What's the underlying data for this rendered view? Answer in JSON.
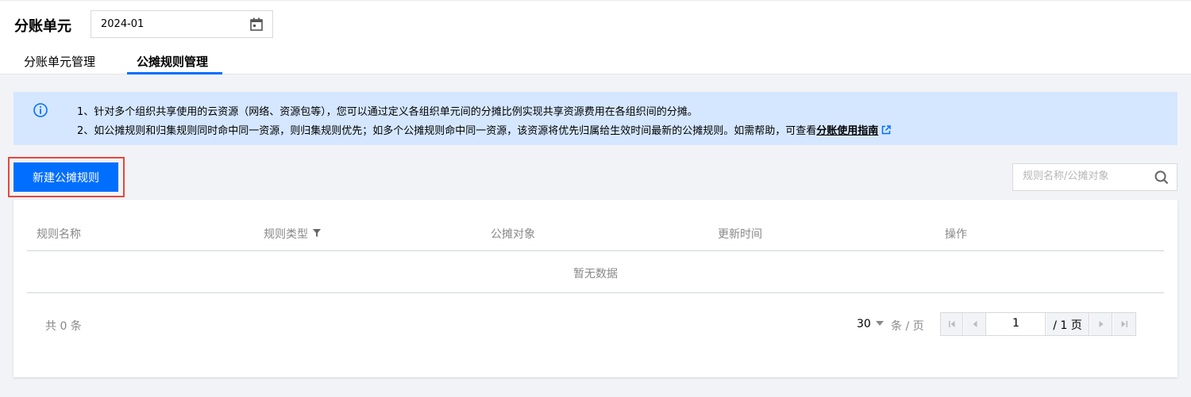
{
  "header": {
    "title": "分账单元",
    "month_value": "2024-01",
    "tabs": [
      {
        "label": "分账单元管理",
        "active": false
      },
      {
        "label": "公摊规则管理",
        "active": true
      }
    ]
  },
  "notice": {
    "line1": "1、针对多个组织共享使用的云资源（网络、资源包等），您可以通过定义各组织单元间的分摊比例实现共享资源费用在各组织间的分摊。",
    "line2_prefix": "2、如公摊规则和归集规则同时命中同一资源，则归集规则优先；如多个公摊规则命中同一资源，该资源将优先归属给生效时间最新的公摊规则。如需帮助，可查看",
    "guide_link": "分账使用指南",
    "icon": "info-icon"
  },
  "toolbar": {
    "create_label": "新建公摊规则",
    "search_placeholder": "规则名称/公摊对象"
  },
  "table": {
    "columns": [
      "规则名称",
      "规则类型",
      "公摊对象",
      "更新时间",
      "操作"
    ],
    "empty_text": "暂无数据"
  },
  "pagination": {
    "total_text": "共 0 条",
    "page_size": "30",
    "page_size_unit": "条 / 页",
    "current_page": "1",
    "total_pages": "/ 1 页"
  },
  "colors": {
    "accent": "#006eff",
    "notice_bg": "#d5e7ff",
    "highlight": "#e5483c"
  }
}
